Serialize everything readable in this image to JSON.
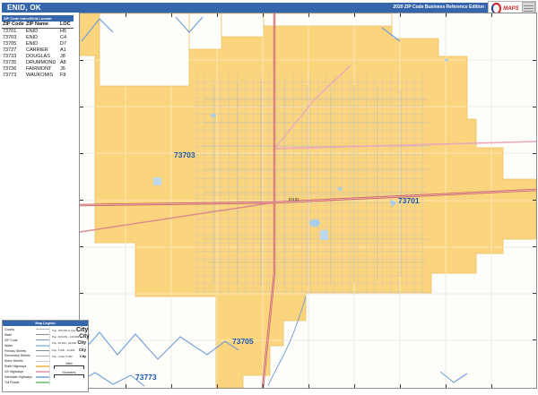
{
  "header": {
    "title": "ENID, OK",
    "edition": "2020 ZIP Code Business Reference Edition",
    "logo": {
      "brand": "MAPS"
    }
  },
  "index_table": {
    "title": "ZIP Code Index/Grid Locator",
    "columns": [
      "ZIP Code",
      "ZIP Name",
      "LOC"
    ],
    "rows": [
      [
        "73701",
        "ENID",
        "H5"
      ],
      [
        "73703",
        "ENID",
        "C4"
      ],
      [
        "73705",
        "ENID",
        "D7"
      ],
      [
        "73727",
        "CARRIER",
        "A1"
      ],
      [
        "73733",
        "DOUGLAS",
        "J8"
      ],
      [
        "73735",
        "DRUMMOND",
        "A8"
      ],
      [
        "73736",
        "FAIRMONT",
        "J6"
      ],
      [
        "73773",
        "WAUKOMIS",
        "F8"
      ]
    ]
  },
  "map": {
    "zip_labels": [
      {
        "text": "73703"
      },
      {
        "text": "73701"
      },
      {
        "text": "73705"
      },
      {
        "text": "73773"
      }
    ],
    "city_label": "ENID"
  },
  "legend": {
    "title": "Map Legend",
    "items": [
      {
        "label": "County"
      },
      {
        "label": "State"
      },
      {
        "label": "ZIP Code"
      },
      {
        "label": "Water"
      },
      {
        "label": "Primary Streets"
      },
      {
        "label": "Secondary Streets"
      },
      {
        "label": "Minor Streets"
      },
      {
        "label": "State Highways"
      },
      {
        "label": "US Highways"
      },
      {
        "label": "Interstate Highways"
      },
      {
        "label": "Toll Roads"
      }
    ],
    "population": [
      {
        "range": "Pop. 250,000 & Over",
        "sample": "City"
      },
      {
        "range": "Pop. 100,000 - 249,999",
        "sample": "City"
      },
      {
        "range": "Pop. 25,000 - 99,999",
        "sample": "City"
      },
      {
        "range": "Pop. 5,000 - 24,999",
        "sample": "City"
      },
      {
        "range": "Pop. Under 5,000",
        "sample": "City"
      }
    ],
    "scales": [
      {
        "label": "Miles"
      },
      {
        "label": "Kilometers"
      }
    ]
  },
  "colors": {
    "header_blue": "#3566ac",
    "zip_fill": "#fbd57e",
    "zip_edge": "#e9bf66",
    "zip_label_blue": "#1b55b0",
    "boundary_blue": "#6f9bd6",
    "highway_red": "#c96262",
    "highway_pink": "#eaa8bd",
    "water_blue": "#a8cdec"
  }
}
